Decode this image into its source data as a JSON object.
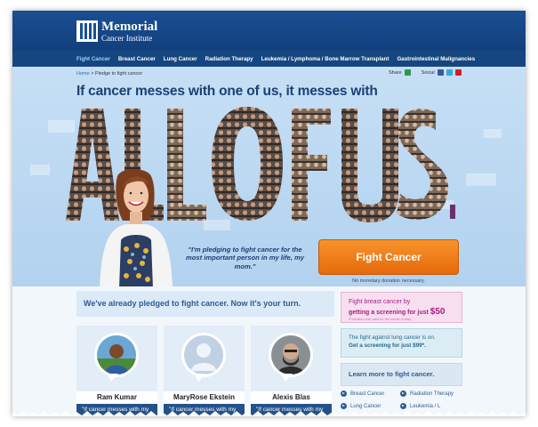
{
  "site": {
    "logo_line1": "Memorial",
    "logo_line2": "Cancer Institute"
  },
  "nav": {
    "items": [
      {
        "label": "Fight Cancer",
        "active": true
      },
      {
        "label": "Breast Cancer"
      },
      {
        "label": "Lung Cancer"
      },
      {
        "label": "Radiation Therapy"
      },
      {
        "label": "Leukemia / Lymphoma / Bone Marrow Transplant"
      },
      {
        "label": "Gastrointestinal Malignancies"
      }
    ]
  },
  "breadcrumb": {
    "home": "Home",
    "separator": " > ",
    "current": "Pledge to fight cancer"
  },
  "share": {
    "share_label": "Share",
    "social_label": "Social"
  },
  "hero": {
    "headline": "If cancer messes with one of us, it messes with",
    "big_text": "ALL OF US.",
    "quote": "\"I'm pledging to fight cancer for the most important person in my life, my mom.\"",
    "cta_label": "Fight Cancer",
    "cta_note": "No monetary donation necessary."
  },
  "pledge": {
    "heading": "We've already pledged to fight cancer. Now it's your turn.",
    "cards": [
      {
        "name": "Ram Kumar",
        "snippet": "\"If cancer messes with my"
      },
      {
        "name": "MaryRose Ekstein",
        "snippet": "\"If cancer messes with my"
      },
      {
        "name": "Alexis Blas",
        "snippet": "\"If cancer messes with my"
      }
    ]
  },
  "sidebar": {
    "ad1_line1": "Fight breast cancer by",
    "ad1_line2a": "getting a screening for just ",
    "ad1_price": "$50",
    "ad1_fine": "Promotion only valid for the month of May.",
    "ad2_line1": "The fight against lung cancer is on.",
    "ad2_line2": "Get a screening for just $99*.",
    "learn_heading": "Learn more to fight cancer.",
    "links": [
      "Breast Cancer",
      "Radiation Therapy",
      "Lung Cancer",
      "Leukemia / L"
    ]
  },
  "colors": {
    "header": "#1a4f93",
    "nav": "#16467f",
    "hero_bg": "#c6dff5",
    "cta": "#f08421",
    "accent_text": "#1d3f74"
  }
}
